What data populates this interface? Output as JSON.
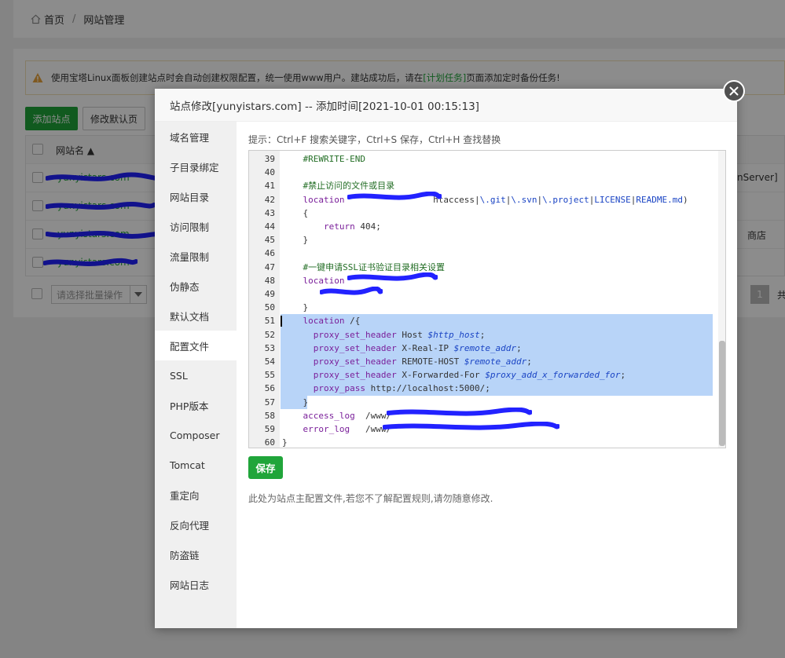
{
  "breadcrumb": {
    "home": "首页",
    "separator": "/",
    "current": "网站管理"
  },
  "alert": {
    "text_before": "使用宝塔Linux面板创建站点时会自动创建权限配置，统一使用www用户。建站成功后，请在",
    "link": "[计划任务]",
    "text_after": "页面添加定时备份任务!"
  },
  "toolbar": {
    "add_site": "添加站点",
    "modify_default": "修改默认页"
  },
  "table": {
    "header": {
      "name": "网站名 ▲"
    },
    "rows": [
      {
        "name": "yunyistars.com",
        "right_text": "nServer]"
      },
      {
        "name": "yunyistars.com",
        "right_text": ""
      },
      {
        "name": "yunyistars.com",
        "right_text": "商店"
      },
      {
        "name": "yunyistars.com",
        "right_text": ""
      }
    ]
  },
  "footer": {
    "bulk_placeholder": "请选择批量操作",
    "page": "1",
    "total": "共"
  },
  "modal": {
    "title": "站点修改[yunyistars.com] -- 添加时间[2021-10-01 00:15:13]",
    "nav": [
      "域名管理",
      "子目录绑定",
      "网站目录",
      "访问限制",
      "流量限制",
      "伪静态",
      "默认文档",
      "配置文件",
      "SSL",
      "PHP版本",
      "Composer",
      "Tomcat",
      "重定向",
      "反向代理",
      "防盗链",
      "网站日志"
    ],
    "active_nav": "配置文件",
    "hint": "提示：Ctrl+F 搜索关键字，Ctrl+S 保存，Ctrl+H 查找替换",
    "save": "保存",
    "note": "此处为站点主配置文件,若您不了解配置规则,请勿随意修改."
  },
  "editor": {
    "lines": [
      {
        "n": "39",
        "text": "    #REWRITE-END"
      },
      {
        "n": "40",
        "text": ""
      },
      {
        "n": "41",
        "text": "    #禁止访问的文件或目录"
      },
      {
        "n": "42",
        "text": "    location                 htaccess|\\.git|\\.svn|\\.project|LICENSE|README.md)"
      },
      {
        "n": "43",
        "text": "    {"
      },
      {
        "n": "44",
        "text": "        return 404;"
      },
      {
        "n": "45",
        "text": "    }"
      },
      {
        "n": "46",
        "text": ""
      },
      {
        "n": "47",
        "text": "    #一键申请SSL证书验证目录相关设置"
      },
      {
        "n": "48",
        "text": "    location"
      },
      {
        "n": "49",
        "text": ""
      },
      {
        "n": "50",
        "text": "    }"
      },
      {
        "n": "51",
        "text": "    location /{"
      },
      {
        "n": "52",
        "text": "      proxy_set_header Host $http_host;"
      },
      {
        "n": "53",
        "text": "      proxy_set_header X-Real-IP $remote_addr;"
      },
      {
        "n": "54",
        "text": "      proxy_set_header REMOTE-HOST $remote_addr;"
      },
      {
        "n": "55",
        "text": "      proxy_set_header X-Forwarded-For $proxy_add_x_forwarded_for;"
      },
      {
        "n": "56",
        "text": "      proxy_pass http://localhost:5000/;"
      },
      {
        "n": "57",
        "text": "    }"
      },
      {
        "n": "58",
        "text": "    access_log  /www/"
      },
      {
        "n": "59",
        "text": "    error_log   /www/"
      },
      {
        "n": "60",
        "text": "}"
      }
    ],
    "selection": [
      "51",
      "57"
    ],
    "colors": {
      "comment": "#236e25",
      "keyword": "#7a1f9a",
      "variable": "#1a44c4",
      "selection": "#b8d4f8"
    }
  },
  "colors": {
    "accent": "#20a53a",
    "redaction": "#2222ff"
  }
}
